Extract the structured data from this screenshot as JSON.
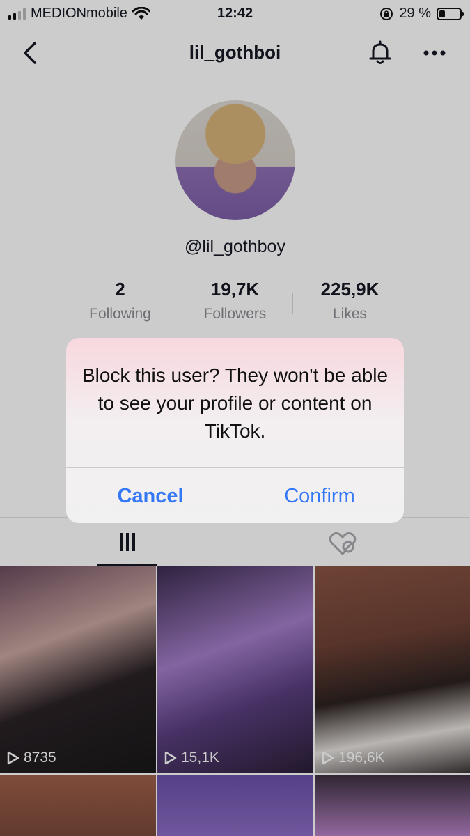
{
  "status_bar": {
    "carrier": "MEDIONmobile",
    "time": "12:42",
    "battery": "29 %",
    "battery_level": 0.29
  },
  "header": {
    "title": "lil_gothboi"
  },
  "profile": {
    "handle": "@lil_gothboy",
    "stats": [
      {
        "value": "2",
        "label": "Following"
      },
      {
        "value": "19,7K",
        "label": "Followers"
      },
      {
        "value": "225,9K",
        "label": "Likes"
      }
    ]
  },
  "alert": {
    "message": "Block this user? They won't be able to see your profile or content on TikTok.",
    "cancel_label": "Cancel",
    "confirm_label": "Confirm"
  },
  "videos": [
    {
      "views": "8735"
    },
    {
      "views": "15,1K"
    },
    {
      "views": "196,6K"
    }
  ],
  "colors": {
    "accent_blue": "#3478f6",
    "text_dark": "#161823",
    "text_muted": "#8a8b91"
  }
}
